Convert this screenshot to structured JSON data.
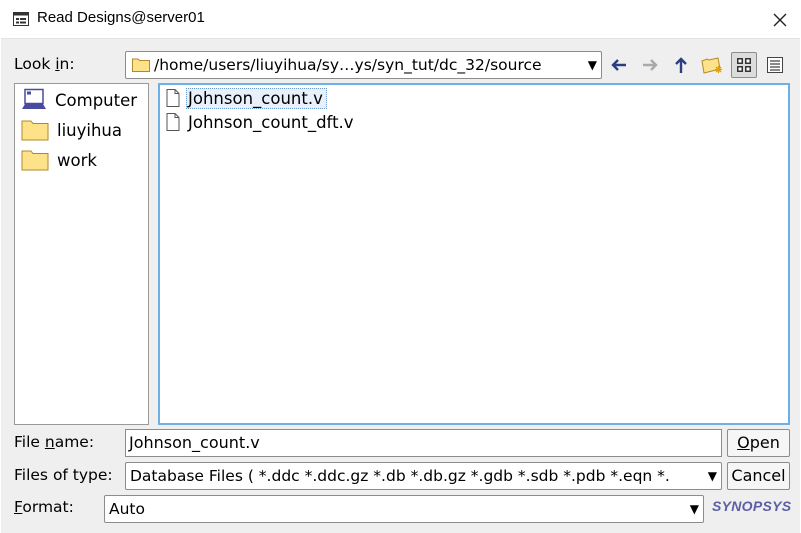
{
  "window": {
    "title": "Read Designs@server01"
  },
  "look_in": {
    "label_prefix": "Look ",
    "label_underlined": "i",
    "label_suffix": "n:",
    "path": "/home/users/liuyihua/sy…ys/syn_tut/dc_32/source"
  },
  "toolbar": {
    "icons": [
      "back-arrow-icon",
      "forward-arrow-icon",
      "up-arrow-icon",
      "new-folder-icon",
      "list-view-icon",
      "details-view-icon"
    ]
  },
  "places": [
    {
      "label": "Computer",
      "icon": "computer-icon"
    },
    {
      "label": "liuyihua",
      "icon": "folder-icon"
    },
    {
      "label": "work",
      "icon": "folder-icon"
    }
  ],
  "files": [
    {
      "name": "Johnson_count.v",
      "selected": true
    },
    {
      "name": "Johnson_count_dft.v",
      "selected": false
    }
  ],
  "file_name": {
    "label_prefix": "File ",
    "label_underlined": "n",
    "label_suffix": "ame:",
    "value": "Johnson_count.v"
  },
  "file_type": {
    "label": "Files of type:",
    "value": "Database Files ( *.ddc *.ddc.gz *.db *.db.gz *.gdb *.sdb *.pdb *.eqn *."
  },
  "format": {
    "label_underlined": "F",
    "label_suffix": "ormat:",
    "value": "Auto"
  },
  "buttons": {
    "open_underlined": "O",
    "open_rest": "pen",
    "cancel": "Cancel"
  },
  "brand": {
    "logo_text": "SYNOPSYS"
  },
  "colors": {
    "selection_border": "#6cb0e6",
    "folder_fill": "#fde28a",
    "brand": "#5b5ea6"
  }
}
